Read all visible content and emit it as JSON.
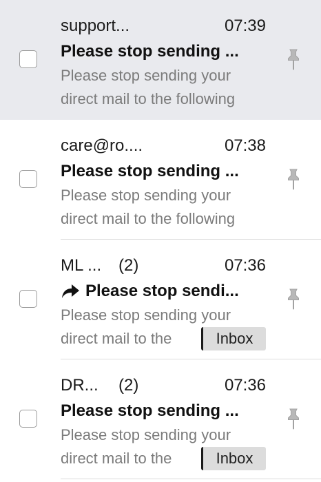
{
  "messages": [
    {
      "sender": "support...",
      "count": "",
      "time": "07:39",
      "subject": "Please stop sending ...",
      "preview_line1": "Please stop sending your",
      "preview_line2": "direct mail to the following",
      "replied": false,
      "folder_badge": "",
      "selected": true
    },
    {
      "sender": "care@ro....",
      "count": "",
      "time": "07:38",
      "subject": "Please stop sending ...",
      "preview_line1": "Please stop sending your",
      "preview_line2": "direct mail to the following",
      "replied": false,
      "folder_badge": "",
      "selected": false
    },
    {
      "sender": "ML ...",
      "count": "(2)",
      "time": "07:36",
      "subject": "Please stop sendi...",
      "preview_line1": "Please stop sending your",
      "preview_line2": "direct mail to the",
      "replied": true,
      "folder_badge": "Inbox",
      "selected": false
    },
    {
      "sender": "DR...",
      "count": "(2)",
      "time": "07:36",
      "subject": "Please stop sending ...",
      "preview_line1": "Please stop sending your",
      "preview_line2": "direct mail to the",
      "replied": false,
      "folder_badge": "Inbox",
      "selected": false
    }
  ],
  "colors": {
    "selected_row_bg": "#e9eaee",
    "preview_text": "#7b7b7b",
    "badge_bg": "#dcdcdc"
  },
  "icons": {
    "reply": "reply-arrow-icon",
    "pin": "pushpin-icon"
  }
}
